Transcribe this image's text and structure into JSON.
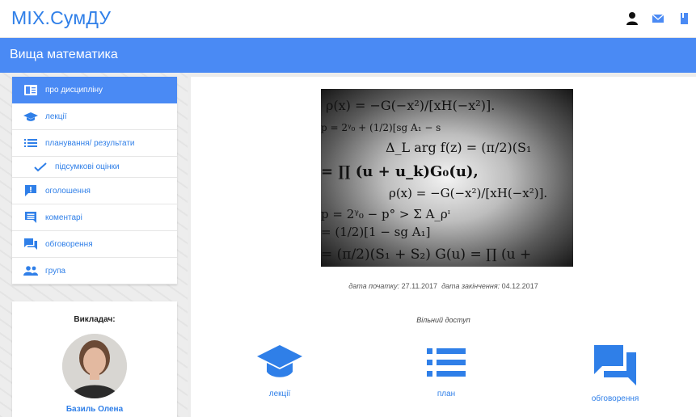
{
  "brand": "МІХ.СумДУ",
  "course_title": "Вища математика",
  "colors": {
    "accent": "#4a8af4",
    "link": "#2f7fe8"
  },
  "top_icons": [
    "user-icon",
    "mail-icon",
    "bookmark-icon"
  ],
  "menu": [
    {
      "label": "про дисципліну",
      "icon": "book-icon",
      "active": true
    },
    {
      "label": "лекції",
      "icon": "graduation-cap-icon"
    },
    {
      "label": "планування/ результати",
      "icon": "list-icon"
    },
    {
      "label": "підсумкові оцінки",
      "icon": "check-icon",
      "sub": true
    },
    {
      "label": "оголошення",
      "icon": "announcement-icon"
    },
    {
      "label": "коментарі",
      "icon": "comment-icon"
    },
    {
      "label": "обговорення",
      "icon": "forum-icon"
    },
    {
      "label": "група",
      "icon": "group-icon"
    }
  ],
  "teacher": {
    "heading": "Викладач:",
    "name": "Базиль Олена"
  },
  "hero_formulas": [
    "ρ(x) = −G(−x²)/[xH(−x²)].",
    "p = 2ᵞ₀ + (1/2)[sg A₁ − s",
    "Δ_L arg f(z) = (π/2)(S₁",
    "= ∏ (u + u_k)G₀(u),",
    "ρ(x) = −G(−x²)/[xH(−x²)].",
    "p = 2ᵞ₀ − p° > Σ A_ρᶦ",
    "= (1/2)[1 − sg A₁]",
    "= (π/2)(S₁ + S₂)  G(u) = ∏ (u +"
  ],
  "dates": {
    "start_label": "дата початку:",
    "start": "27.11.2017",
    "end_label": "дата закінчення:",
    "end": "04.12.2017"
  },
  "access": "Вільний доступ",
  "quick_links": [
    {
      "label": "лекції",
      "icon": "graduation-cap-icon"
    },
    {
      "label": "план",
      "icon": "list-icon"
    },
    {
      "label": "обговорення",
      "icon": "forum-icon"
    }
  ]
}
